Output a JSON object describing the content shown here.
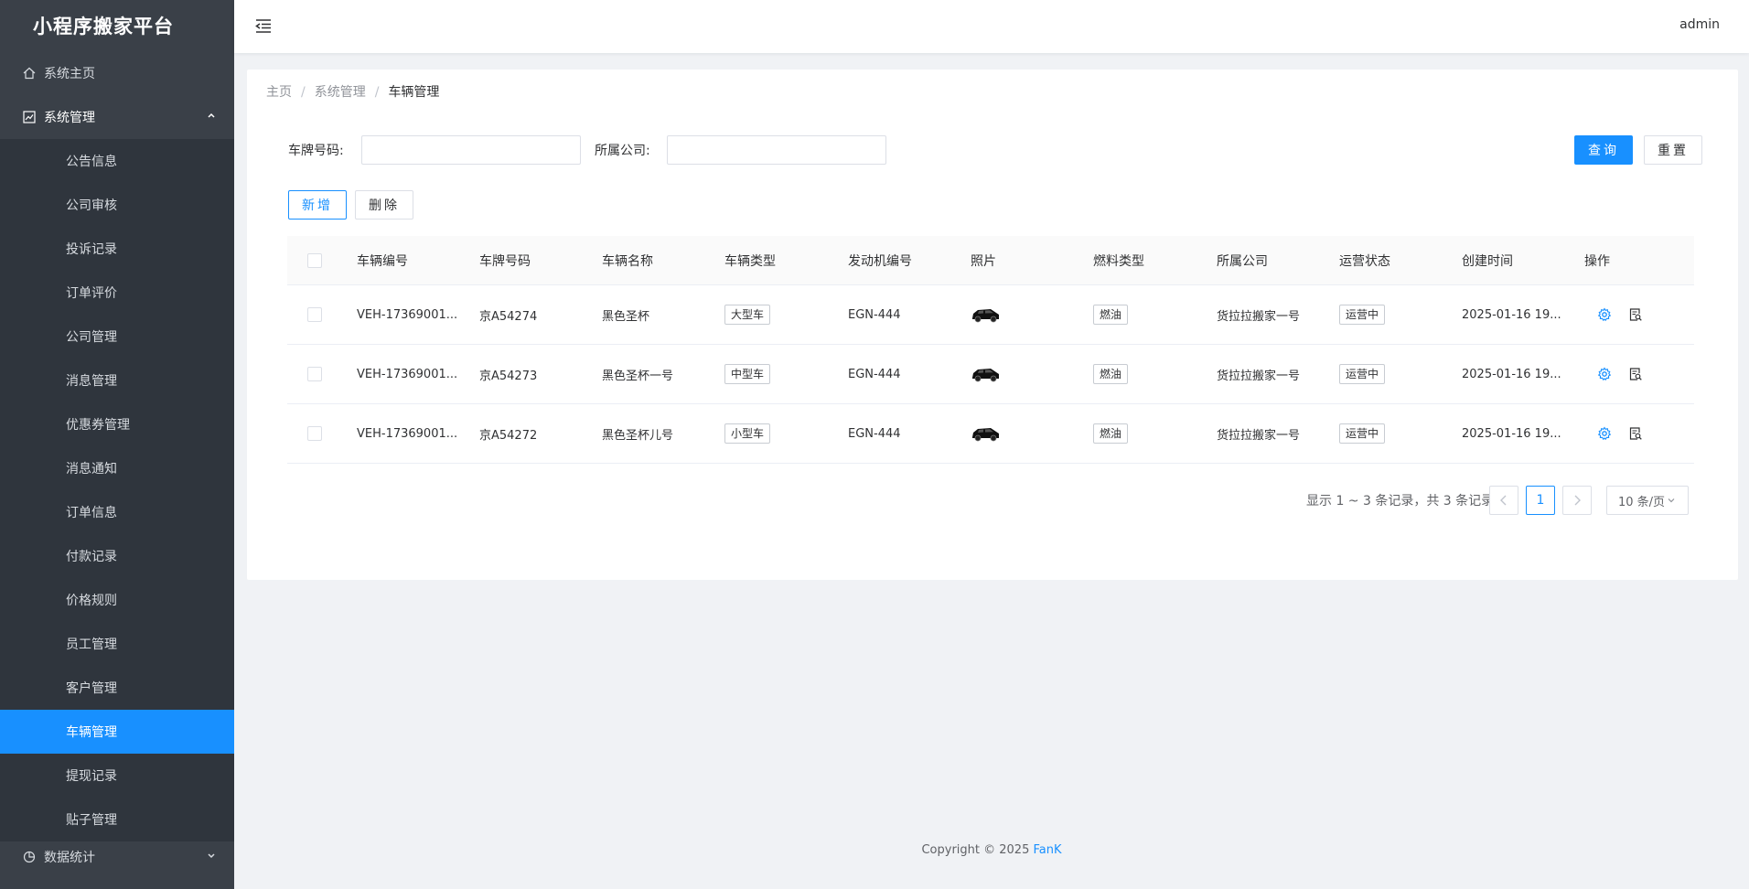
{
  "app": {
    "title": "小程序搬家平台"
  },
  "sidebar": {
    "home": "系统主页",
    "system": "系统管理",
    "sub_items": [
      "公告信息",
      "公司审核",
      "投诉记录",
      "订单评价",
      "公司管理",
      "消息管理",
      "优惠券管理",
      "消息通知",
      "订单信息",
      "付款记录",
      "价格规则",
      "员工管理",
      "客户管理",
      "车辆管理",
      "提现记录",
      "贴子管理"
    ],
    "stats": "数据统计"
  },
  "header": {
    "user": "admin"
  },
  "breadcrumb": {
    "home": "主页",
    "parent": "系统管理",
    "current": "车辆管理"
  },
  "search": {
    "plate_label": "车牌号码:",
    "plate_value": "",
    "company_label": "所属公司:",
    "company_value": "",
    "query_button": "查询",
    "reset_button": "重置"
  },
  "toolbar": {
    "add_button": "新增",
    "delete_button": "删除"
  },
  "table": {
    "columns": [
      "车辆编号",
      "车牌号码",
      "车辆名称",
      "车辆类型",
      "发动机编号",
      "照片",
      "燃料类型",
      "所属公司",
      "运营状态",
      "创建时间",
      "操作"
    ],
    "rows": [
      {
        "vehicle_no": "VEH-17369001...",
        "plate": "京A54274",
        "name": "黑色圣杯",
        "type": "大型车",
        "engine": "EGN-444",
        "fuel": "燃油",
        "company": "货拉拉搬家一号",
        "status": "运营中",
        "created": "2025-01-16 19..."
      },
      {
        "vehicle_no": "VEH-17369001...",
        "plate": "京A54273",
        "name": "黑色圣杯一号",
        "type": "中型车",
        "engine": "EGN-444",
        "fuel": "燃油",
        "company": "货拉拉搬家一号",
        "status": "运营中",
        "created": "2025-01-16 19..."
      },
      {
        "vehicle_no": "VEH-17369001...",
        "plate": "京A54272",
        "name": "黑色圣杯儿号",
        "type": "小型车",
        "engine": "EGN-444",
        "fuel": "燃油",
        "company": "货拉拉搬家一号",
        "status": "运营中",
        "created": "2025-01-16 19..."
      }
    ]
  },
  "pagination": {
    "summary": "显示 1 ~ 3 条记录，共 3 条记录",
    "current_page": "1",
    "page_size": "10 条/页"
  },
  "footer": {
    "copyright": "Copyright © 2025 ",
    "brand": "FanK"
  },
  "colors": {
    "primary": "#1890ff",
    "sidebar_bg": "#3a4048",
    "submenu_bg": "#2f353d"
  }
}
